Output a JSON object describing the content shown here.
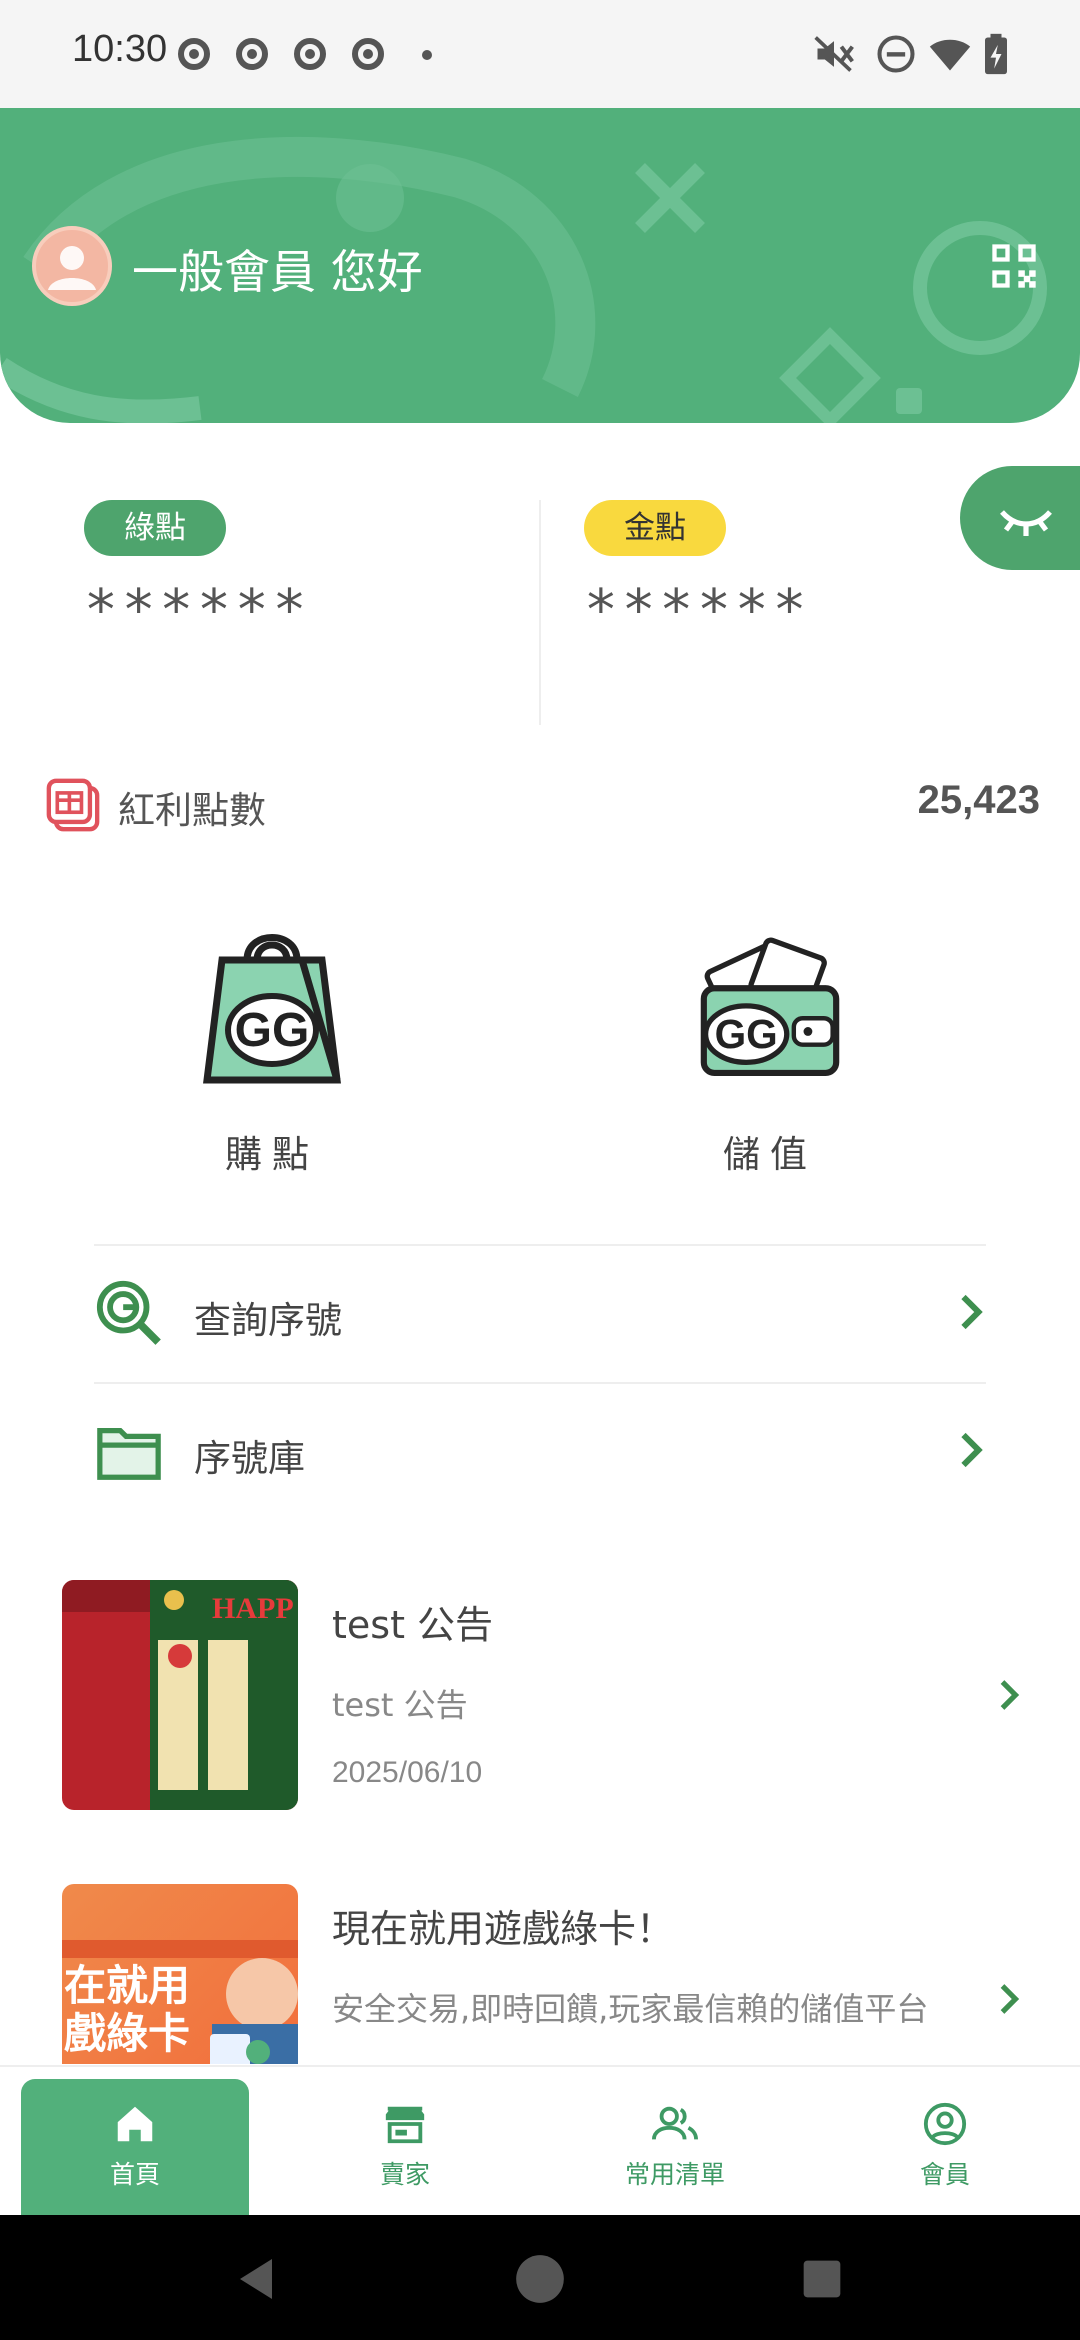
{
  "status_bar": {
    "time": "10:30",
    "notification_icons": [
      "chrome-icon",
      "chrome-icon",
      "chrome-icon",
      "chrome-icon"
    ],
    "right_icons": [
      "mute-icon",
      "dnd-icon",
      "wifi-icon",
      "battery-icon"
    ]
  },
  "header": {
    "greeting": "一般會員 您好",
    "qr_icon": "qr-code-icon"
  },
  "points": {
    "green": {
      "label": "綠點",
      "value": "******"
    },
    "gold": {
      "label": "金點",
      "value": "******"
    }
  },
  "bonus": {
    "label": "紅利點數",
    "value": "25,423"
  },
  "actions": [
    {
      "label": "購點",
      "icon": "shopping-bag-icon"
    },
    {
      "label": "儲值",
      "icon": "wallet-icon"
    }
  ],
  "menu": [
    {
      "label": "查詢序號",
      "icon": "search-serial-icon"
    },
    {
      "label": "序號庫",
      "icon": "folder-icon"
    }
  ],
  "news": [
    {
      "title": "test 公告",
      "subtitle": "test 公告",
      "date": "2025/06/10",
      "thumb_text": "HAPP"
    },
    {
      "title": "現在就用遊戲綠卡！",
      "subtitle": "安全交易,即時回饋,玩家最信賴的儲值平台",
      "thumb_text": "在就用 戲綠卡"
    }
  ],
  "bottom_nav": [
    {
      "label": "首頁",
      "icon": "home-icon",
      "active": true
    },
    {
      "label": "賣家",
      "icon": "store-icon",
      "active": false
    },
    {
      "label": "常用清單",
      "icon": "people-icon",
      "active": false
    },
    {
      "label": "會員",
      "icon": "account-icon",
      "active": false
    }
  ],
  "colors": {
    "primary": "#52b07b",
    "gold": "#f9d93e",
    "bonus_red": "#e0525c"
  }
}
